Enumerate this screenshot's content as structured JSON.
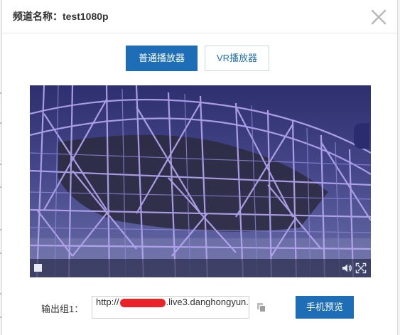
{
  "dialog": {
    "title": "频道名称：test1080p",
    "close_icon": "close-icon"
  },
  "tabs": [
    {
      "label": "普通播放器",
      "active": true
    },
    {
      "label": "VR播放器",
      "active": false
    }
  ],
  "player": {
    "controls": {
      "stop_icon": "stop-icon",
      "volume_icon": "volume-icon",
      "fullscreen_icon": "fullscreen-icon"
    }
  },
  "output": {
    "label": "输出组1：",
    "url_prefix": "http://",
    "url_suffix": ".live3.danghongyun.",
    "copy_icon": "copy-icon",
    "preview_label": "手机预览"
  },
  "colors": {
    "primary": "#1d6eb7",
    "redaction": "#e8232a"
  }
}
